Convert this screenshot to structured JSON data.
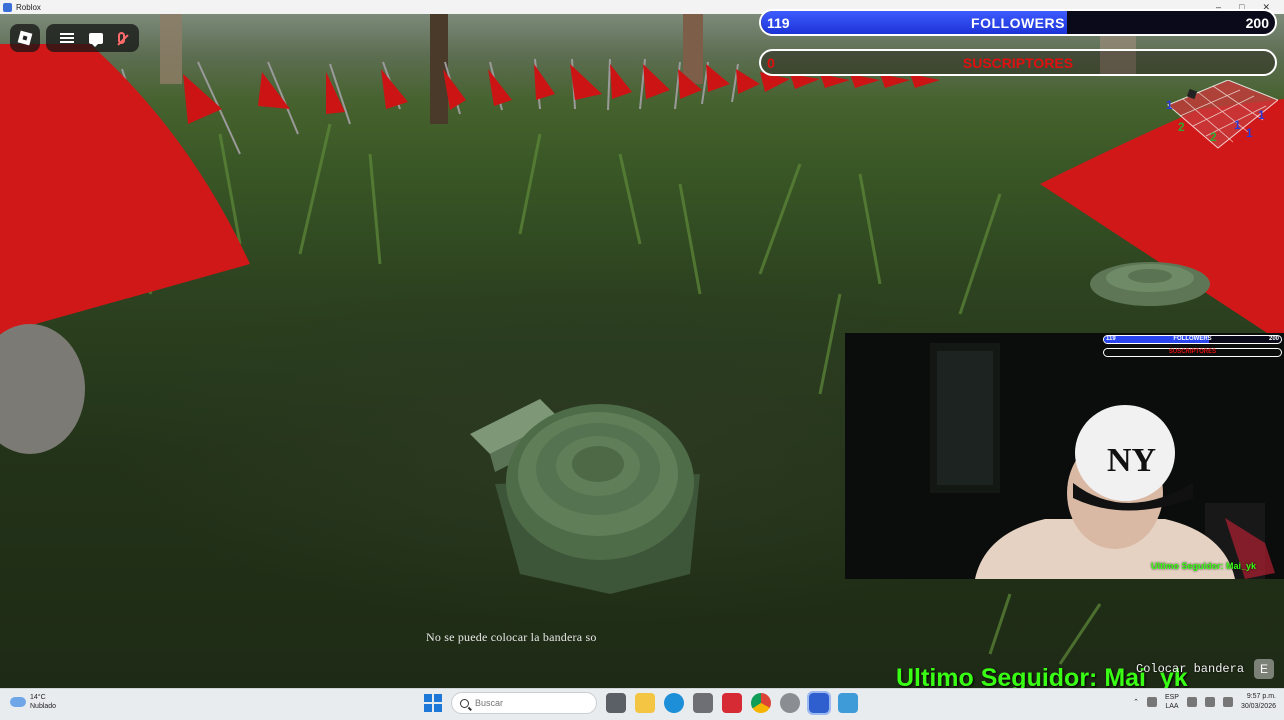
{
  "window": {
    "title": "Roblox"
  },
  "roblox_ui": {
    "menu_icon": "roblox-logo-icon",
    "toolbar_icons": [
      "hamburger-menu-icon",
      "chat-icon",
      "microphone-muted-icon"
    ]
  },
  "stream_overlay": {
    "followers": {
      "current": "119",
      "label": "FOLLOWERS",
      "goal": "200",
      "progress": 0.595,
      "color": "#2a45ee"
    },
    "subscribers": {
      "label": "SUSCRIPTORES",
      "start": "0",
      "color": "#e01010"
    },
    "minimap": {
      "numbers": [
        "1",
        "1",
        "2",
        "2",
        "1",
        "1"
      ]
    },
    "webcam": {
      "followers_current": "119",
      "followers_label": "FOLLOWERS",
      "followers_goal": "200",
      "subscribers_label": "SUSCRIPTORES",
      "last_follower": "Ultimo Seguidor: Mai_yk",
      "cap_logo": "NY"
    },
    "last_follower": "Ultimo Seguidor: Mai_yk",
    "accent_green": "#39ff14"
  },
  "game": {
    "message": "No se puede colocar la bandera so",
    "action_prompt": "Colocar bandera",
    "action_key": "E"
  },
  "taskbar": {
    "weather_temp": "14°C",
    "weather_desc": "Nublado",
    "search_placeholder": "Buscar",
    "lang_top": "ESP",
    "lang_bottom": "LAA",
    "time": "9:57 p.m.",
    "date": "30/03/2026",
    "pinned_apps": [
      "task-view-icon",
      "file-explorer-icon",
      "edge-icon",
      "store-icon",
      "roblox-studio-icon",
      "chrome-icon",
      "settings-icon",
      "roblox-icon",
      "photos-icon"
    ]
  }
}
